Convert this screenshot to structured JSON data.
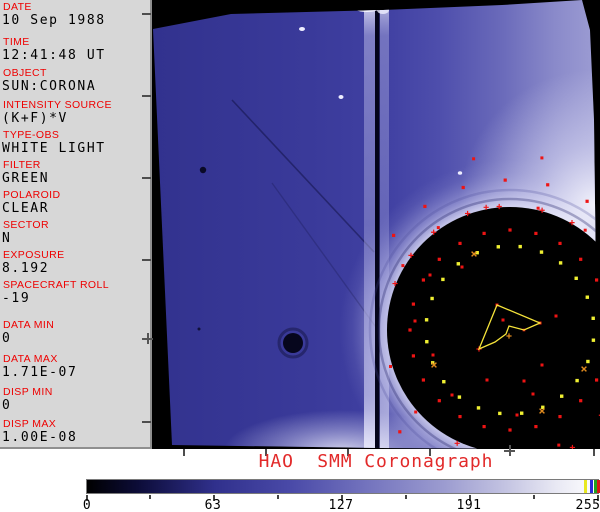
{
  "metadata_panel": {
    "fields": [
      {
        "label": "DATE",
        "value": "10 Sep 1988"
      },
      {
        "label": "TIME",
        "value": "12:41:48 UT"
      },
      {
        "label": "OBJECT",
        "value": "SUN:CORONA"
      },
      {
        "label": "INTENSITY SOURCE",
        "value": "(K+F)*V"
      },
      {
        "label": "TYPE-OBS",
        "value": "WHITE LIGHT"
      },
      {
        "label": "FILTER",
        "value": "GREEN"
      },
      {
        "label": "POLAROID",
        "value": "CLEAR"
      },
      {
        "label": "SECTOR",
        "value": "N"
      },
      {
        "label": "EXPOSURE",
        "value": "8.192"
      },
      {
        "label": "SPACECRAFT ROLL",
        "value": "-19"
      },
      {
        "label": "DATA MIN",
        "value": "0"
      },
      {
        "label": "DATA MAX",
        "value": "1.71E-07"
      },
      {
        "label": "DISP MIN",
        "value": "0"
      },
      {
        "label": "DISP MAX",
        "value": "1.00E-08"
      }
    ]
  },
  "image": {
    "title": "HAO  SMM Coronagraph"
  },
  "colorbar": {
    "tick_labels": [
      "0",
      "63",
      "127",
      "191",
      "255"
    ]
  },
  "colors": {
    "label_red": "#ee0000",
    "title_red": "#e22a2a",
    "panel_gray": "#d7d7d7",
    "image_blue": "#3a3a9a",
    "dot_red": "#ee1414",
    "dot_yellow": "#f0f032",
    "dot_orange": "#e08a1e",
    "polygon_yellow": "#f5e33a"
  }
}
